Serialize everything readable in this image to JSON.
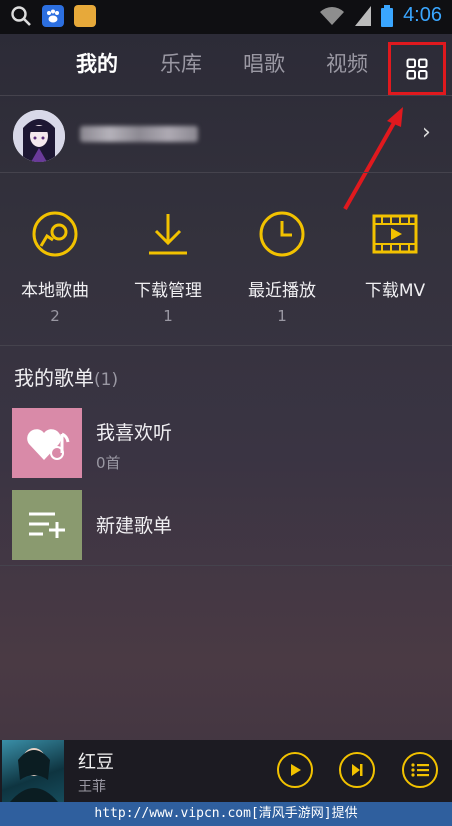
{
  "status_bar": {
    "time": "4:06",
    "icons": [
      "search-icon",
      "baidu-icon",
      "app-icon",
      "wifi-icon",
      "signal-icon",
      "battery-icon"
    ]
  },
  "tabs": [
    {
      "label": "我的",
      "active": true
    },
    {
      "label": "乐库",
      "active": false
    },
    {
      "label": "唱歌",
      "active": false
    },
    {
      "label": "视频",
      "active": false
    }
  ],
  "user": {
    "name_blurred": true
  },
  "quick_actions": [
    {
      "label": "本地歌曲",
      "count": "2",
      "icon": "disc-icon"
    },
    {
      "label": "下载管理",
      "count": "1",
      "icon": "download-icon"
    },
    {
      "label": "最近播放",
      "count": "1",
      "icon": "clock-icon"
    },
    {
      "label": "下载MV",
      "count": "",
      "icon": "film-icon"
    }
  ],
  "playlists": {
    "title": "我的歌单",
    "count": "(1)",
    "items": [
      {
        "name": "我喜欢听",
        "sub": "0首",
        "color": "#d98aa8",
        "icon": "heart-note-icon"
      },
      {
        "name": "新建歌单",
        "sub": "",
        "color": "#8a9a6f",
        "icon": "add-list-icon"
      }
    ]
  },
  "player": {
    "song": "红豆",
    "artist": "王菲"
  },
  "watermark": "http://www.vipcn.com[清风手游网]提供",
  "colors": {
    "accent": "#f2c200",
    "highlight": "#e0191e"
  }
}
